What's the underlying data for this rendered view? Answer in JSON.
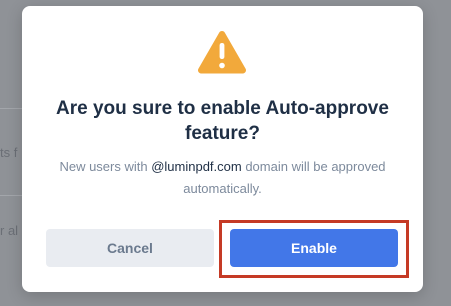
{
  "backdrop": {
    "text_1": "ts f",
    "text_2": "r al"
  },
  "dialog": {
    "icon": "warning-triangle-icon",
    "title": "Are you sure to enable Auto-approve feature?",
    "description_prefix": "New users with ",
    "description_email": "@luminpdf.com",
    "description_suffix": " domain will be approved automatically.",
    "cancel_label": "Cancel",
    "enable_label": "Enable"
  },
  "colors": {
    "warning": "#F2A93B",
    "primary": "#4277E8",
    "cancel_bg": "#E9ECF1",
    "title": "#1F2F45",
    "highlight": "#C53A25"
  }
}
